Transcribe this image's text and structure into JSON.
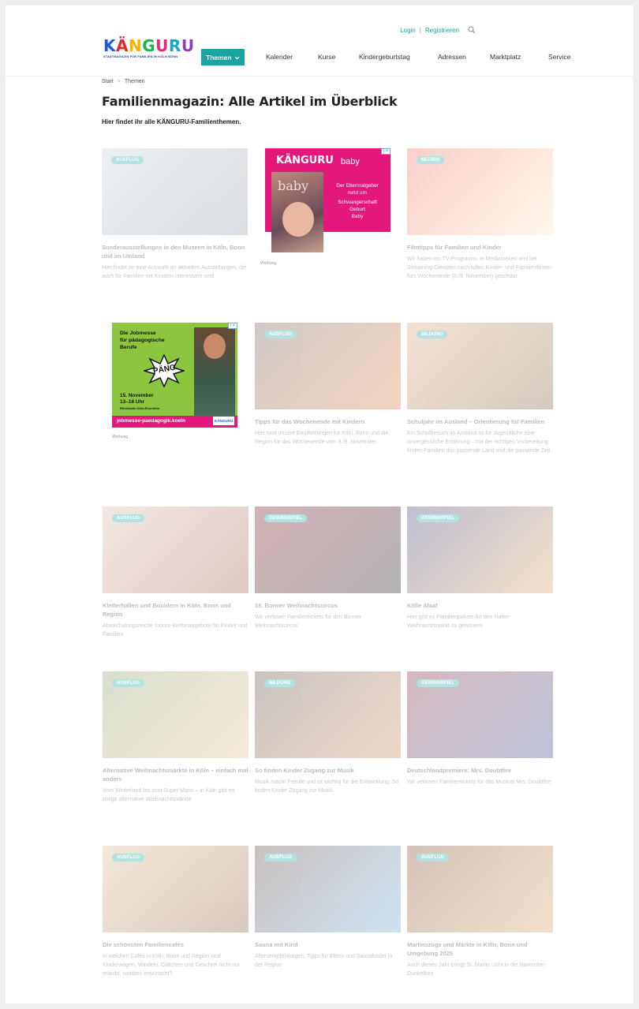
{
  "header": {
    "login": "Login",
    "separator": "|",
    "register": "Registrieren",
    "logo_text": "KÄNGURU",
    "logo_letters": [
      "K",
      "Ä",
      "N",
      "G",
      "U",
      "R",
      "U"
    ],
    "logo_colors": [
      "#1d5bd8",
      "#e8262d",
      "#f4b400",
      "#1db24a",
      "#e8267a",
      "#1aa3c7",
      "#8a3fc1"
    ],
    "logo_sub": "STADTMAGAZIN FÜR FAMILIEN IN KÖLN BONN"
  },
  "nav": {
    "themen": "Themen",
    "items": [
      "Kalender",
      "Kurse",
      "Kindergeburtstag",
      "Adressen",
      "Marktplatz",
      "Service"
    ]
  },
  "breadcrumb": {
    "start": "Start",
    "sep": ">",
    "current": "Themen"
  },
  "page": {
    "title": "Familienmagazin: Alle Artikel im Überblick",
    "intro": "Hier findet ihr alle KÄNGURU-Familienthemen."
  },
  "ads": {
    "baby": {
      "brand": "KÄNGURU",
      "brand_suffix": "baby",
      "line1": "Der Elternratgeber",
      "line2": "rund um",
      "line3": "Schwangerschaft",
      "line4": "Geburt",
      "line5": "Baby",
      "cover_word": "baby",
      "label": "Werbung",
      "adchoice": "i ×"
    },
    "jobmesse": {
      "line1": "Die Jobmesse",
      "line2": "für pädagogische",
      "line3": "Berufe",
      "burst": "PÄNG",
      "date": "15. November",
      "time": "13–16 Uhr",
      "place": "Rheinhalle Köln-Ehrenfeld",
      "url": "jobmesse-paedagogik.koeln",
      "logo": "KÄNGURU",
      "label": "Werbung",
      "adchoice": "i ×"
    }
  },
  "cards": [
    {
      "tag": "AUSFLUG",
      "title": "Sonderausstellungen in den Museen in Köln, Bonn und im Umland",
      "text": "Hier findet ihr eine Auswahl an aktuellen Ausstellungen, die auch für Familien mit Kindern interessant sind",
      "color": "#c9d3da",
      "color2": "#8c99a3"
    },
    {
      "tag": "MEDIEN",
      "title": "Filmtipps für Familien und Kinder",
      "text": "Wir haben ins TV-Programm, in Mediatheken und bei Streaming-Diensten nach tollen Kinder- und Familienfilmen fürs Wochenende (8./9. November) geschaut",
      "color": "#f26b5b",
      "color2": "#ffe9c7"
    },
    {
      "tag": "AUSFLUG",
      "title": "Tipps für das Wochenende mit Kindern",
      "text": "Hier sind unsere Empfehlungen für Köln, Bonn und die Region für das Wochenende vom 8./9. November",
      "color": "#6b5a55",
      "color2": "#e07a3a"
    },
    {
      "tag": "BILDUNG",
      "title": "Schuljahr im Ausland – Orientierung für Familien",
      "text": "Ein Schulbesuch im Ausland ist für Jugendliche eine unvergessliche Erfahrung – mit der richtigen Vorbereitung finden Familien das passende Land und die passende Zeit.",
      "color": "#d9a77a",
      "color2": "#7a5a3a"
    },
    {
      "tag": "AUSFLUG",
      "title": "Kletterhallen und Bouldern in Köln, Bonn und Region",
      "text": "Abwechslungsreiche Indoor-Kletterangebote für Kinder und Familien",
      "color": "#d8b8a8",
      "color2": "#9a5a4a"
    },
    {
      "tag": "GEWINNSPIEL",
      "title": "18. Bonner Weihnachtscircus",
      "text": "Wir verlosen Familientickets für den Bonner Weihnachtscircus",
      "color": "#7a1220",
      "color2": "#1a1a1a"
    },
    {
      "tag": "GEWINNSPIEL",
      "title": "Kölle Alaaf",
      "text": "Hier gibt es Familienpakete für den Hafen-Weihnachtsmarkt zu gewinnen",
      "color": "#3a3a6a",
      "color2": "#d8a060"
    },
    {
      "tag": "AUSFLUG",
      "title": "Alternative Weihnachtsmärkte in Köln – einfach mal anders",
      "text": "Vom Winterland bis zum Super Mario – in Köln gibt es einige alternative Weihnachtsmärkte",
      "color": "#8a9a6a",
      "color2": "#e0c090"
    },
    {
      "tag": "BILDUNG",
      "title": "So finden Kinder Zugang zur Musik",
      "text": "Musik macht Freude und ist wichtig für die Entwicklung. So finden Kinder Zugang zur Musik.",
      "color": "#5a4a40",
      "color2": "#c88a60"
    },
    {
      "tag": "GEWINNSPIEL",
      "title": "Deutschlandpremiere: Mrs. Doubtfire",
      "text": "Wir verlosen Familientickets für das Musical Mrs. Doubtfire",
      "color": "#7a2a3a",
      "color2": "#3a4a8a"
    },
    {
      "tag": "AUSFLUG",
      "title": "Die schönsten Familiencafés",
      "text": "In welchen Cafés in Köln, Bonn und Region sind Kinderwagen, Windeln, Glätchen und Geschrei nicht nur erlaubt, sondern erwünscht?",
      "color": "#d8b890",
      "color2": "#8a5a3a"
    },
    {
      "tag": "AUSFLUG",
      "title": "Sauna mit Kind",
      "text": "Altersempfehlungen, Tipps für Eltern und Saunabäder in der Region",
      "color": "#5a4038",
      "color2": "#6aa8d8"
    },
    {
      "tag": "AUSFLUG",
      "title": "Martinszüge und Märkte in Köln, Bonn und Umgebung 2025",
      "text": "Auch dieses Jahr bringt St. Martin Licht in die November-Dunkelheit",
      "color": "#7a4a28",
      "color2": "#d8a060"
    }
  ]
}
